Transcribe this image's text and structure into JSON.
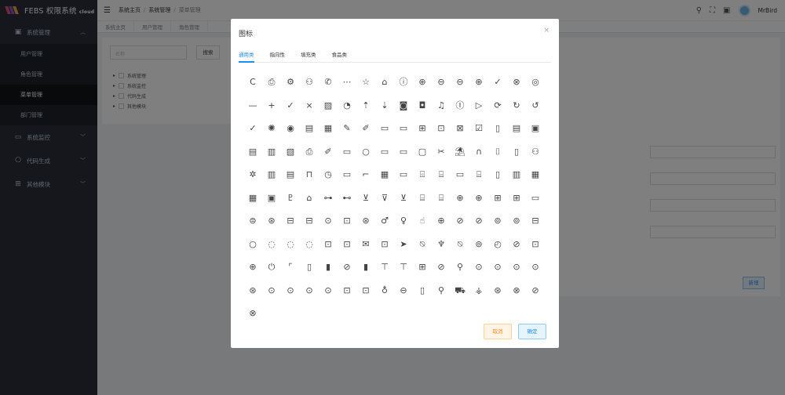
{
  "app": {
    "logo_text": "FEBS 权限系统",
    "logo_suffix": "cloud",
    "logo_colors": [
      "#e94e77",
      "#7b5cd6",
      "#f0a93b"
    ]
  },
  "sidebar": {
    "groups": [
      {
        "label": "系统管理",
        "icon": "▣",
        "expanded": true,
        "items": [
          {
            "label": "用户管理",
            "active": false
          },
          {
            "label": "角色管理",
            "active": false
          },
          {
            "label": "菜单管理",
            "active": true
          },
          {
            "label": "部门管理",
            "active": false
          }
        ]
      },
      {
        "label": "系统监控",
        "icon": "▭",
        "expanded": false
      },
      {
        "label": "代码生成",
        "icon": "⎔",
        "expanded": false
      },
      {
        "label": "其他模块",
        "icon": "⊞",
        "expanded": false
      }
    ]
  },
  "header": {
    "breadcrumb": [
      "系统主页",
      "系统管理",
      "菜单管理"
    ],
    "username": "MrBird"
  },
  "tags": [
    "系统主页",
    "用户管理",
    "角色管理"
  ],
  "main": {
    "search_placeholder": "名称",
    "search_button": "搜索",
    "tree": [
      "系统管理",
      "系统监控",
      "代码生成",
      "其他模块"
    ],
    "add_button": "新增"
  },
  "modal": {
    "title": "图标",
    "close": "×",
    "tabs": [
      {
        "label": "通用类",
        "active": true
      },
      {
        "label": "指向性",
        "active": false
      },
      {
        "label": "填充类",
        "active": false
      },
      {
        "label": "食品类",
        "active": false
      }
    ],
    "icons": [
      "C",
      "⎙",
      "⚙",
      "⚇",
      "✆",
      "⋯",
      "☆",
      "⌂",
      "ⓘ",
      "⊕",
      "⊖",
      "⊖",
      "⊕",
      "✓",
      "⊗",
      "◎",
      "—",
      "+",
      "✓",
      "×",
      "▨",
      "◔",
      "⇡",
      "⇣",
      "◙",
      "◘",
      "♫",
      "Ⓘ",
      "▷",
      "⟳",
      "↻",
      "↺",
      "✓",
      "✺",
      "◉",
      "▤",
      "▦",
      "✎",
      "✐",
      "▭",
      "▭",
      "⊞",
      "⊡",
      "⊠",
      "☑",
      "▯",
      "▤",
      "▣",
      "▤",
      "▥",
      "▧",
      "⎙",
      "✐",
      "▭",
      "○",
      "▭",
      "▭",
      "▢",
      "✂",
      "⛱",
      "∩",
      "⌷",
      "▯",
      "⚇",
      "✲",
      "▥",
      "▤",
      "⊓",
      "◷",
      "▭",
      "⌐",
      "▦",
      "▭",
      "⌹",
      "⌸",
      "▭",
      "⌸",
      "▯",
      "▥",
      "▦",
      "▦",
      "▣",
      "♇",
      "⌂",
      "⊶",
      "⊷",
      "⊻",
      "⊽",
      "⊻",
      "⌸",
      "⌸",
      "⊕",
      "⊕",
      "⊞",
      "⊞",
      "▭",
      "⊜",
      "⊛",
      "⊟",
      "⊟",
      "⊙",
      "⊡",
      "⊛",
      "♂",
      "♀",
      "☝",
      "⊕",
      "⊘",
      "⊘",
      "⊚",
      "⊚",
      "⊟",
      "○",
      "◌",
      "◌",
      "◌",
      "⊡",
      "⊡",
      "✉",
      "⊡",
      "➤",
      "⍉",
      "♆",
      "⍉",
      "⊚",
      "◴",
      "⊘",
      "⊡",
      "⊕",
      "⏻",
      "⌜",
      "▯",
      "▮",
      "⊘",
      "▮",
      "⊤",
      "⊤",
      "⊞",
      "⊘",
      "⚲",
      "⊙",
      "⊙",
      "⊙",
      "⊙",
      "⊛",
      "⊙",
      "⊙",
      "⊙",
      "⊙",
      "⊡",
      "⊡",
      "♁",
      "⊖",
      "▯",
      "⚲",
      "⛟",
      "⚶",
      "⊛",
      "⊗",
      "⊘",
      "⊗"
    ],
    "cancel": "取消",
    "ok": "确定"
  }
}
